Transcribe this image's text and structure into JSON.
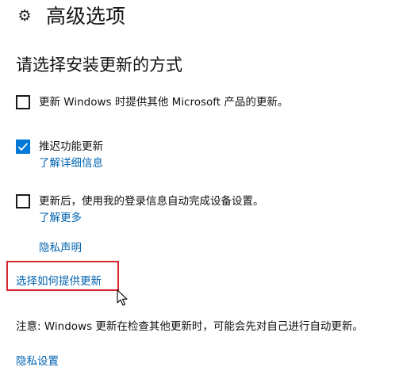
{
  "header": {
    "icon": "gear-icon",
    "title": "高级选项"
  },
  "section": {
    "heading": "请选择安装更新的方式"
  },
  "options": [
    {
      "label": "更新 Windows 时提供其他 Microsoft 产品的更新。",
      "checked": false
    },
    {
      "label": "推迟功能更新",
      "checked": true,
      "link": "了解详细信息"
    },
    {
      "label": "更新后，使用我的登录信息自动完成设备设置。",
      "checked": false,
      "link": "了解更多"
    }
  ],
  "links": {
    "privacy_statement": "隐私声明",
    "choose_delivery": "选择如何提供更新",
    "privacy_settings": "隐私设置"
  },
  "note": "注意: Windows 更新在检查其他更新时，可能会先对自己进行自动更新。",
  "colors": {
    "accent": "#0078d7",
    "link": "#0063b1",
    "highlight": "#d9272e"
  }
}
